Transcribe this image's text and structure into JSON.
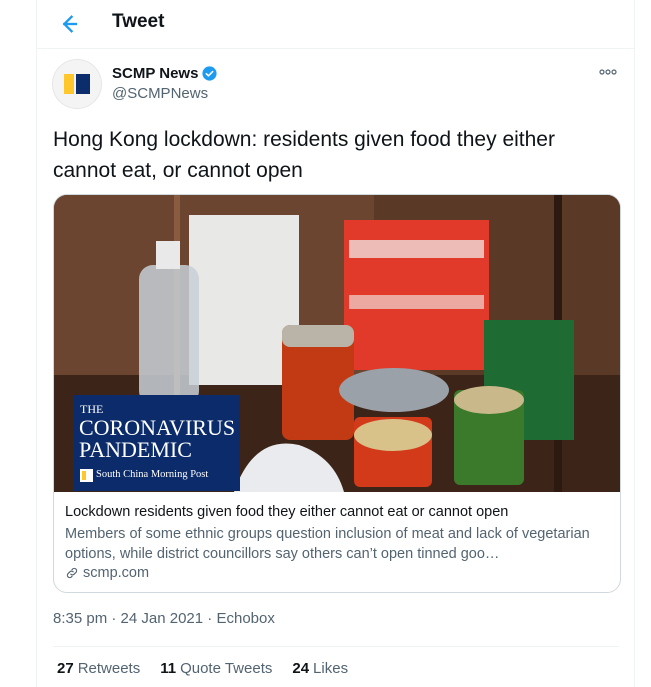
{
  "header": {
    "title": "Tweet",
    "back_icon": "arrow-left-icon"
  },
  "author": {
    "name": "SCMP News",
    "handle": "@SCMPNews",
    "verified": true,
    "avatar_colors": [
      "#ffc72c",
      "#0b2d6b"
    ]
  },
  "tweet": {
    "text": "Hong Kong lockdown: residents given food they either cannot eat, or cannot open"
  },
  "card": {
    "image_overlay": {
      "line0": "THE",
      "line1": "CORONAVIRUS",
      "line2": "PANDEMIC",
      "brand": "South China Morning Post"
    },
    "title": "Lockdown residents given food they either cannot eat or cannot open",
    "description": "Members of some ethnic groups question inclusion of meat and lack of vegetarian options, while district councillors say others can’t open tinned goo…",
    "domain": "scmp.com"
  },
  "meta": {
    "time": "8:35 pm",
    "date": "24 Jan 2021",
    "source": "Echobox",
    "sep": "·"
  },
  "stats": [
    {
      "count": "27",
      "label": "Retweets"
    },
    {
      "count": "11",
      "label": "Quote Tweets"
    },
    {
      "count": "24",
      "label": "Likes"
    }
  ],
  "colors": {
    "accent": "#1d9bf0",
    "text": "#0f1419",
    "secondary": "#536471",
    "border": "#cfd9de"
  }
}
